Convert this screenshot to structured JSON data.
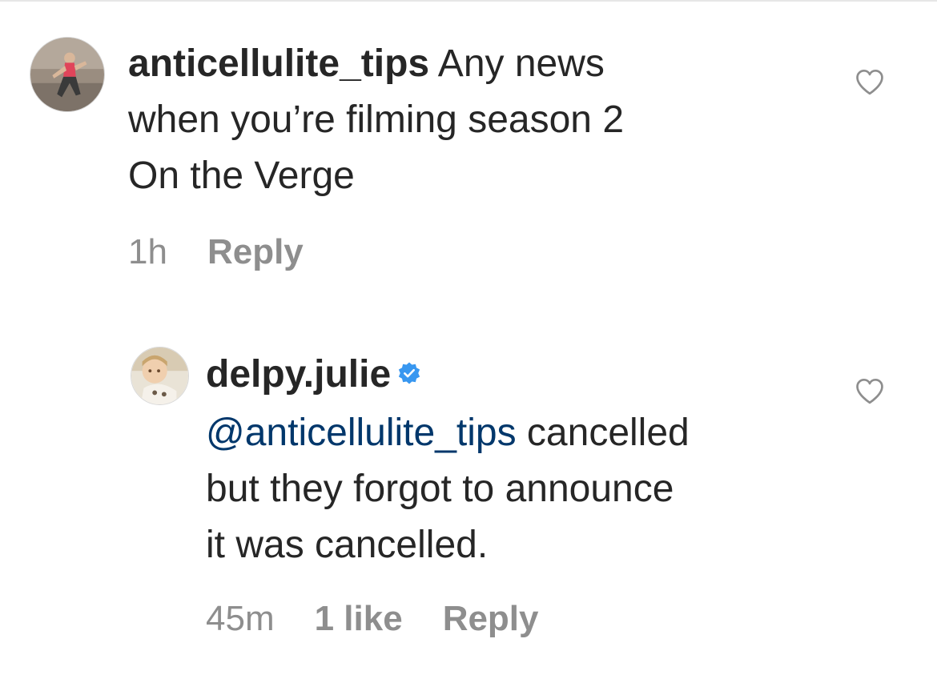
{
  "comments": [
    {
      "username": "anticellulite_tips",
      "text_line1": " Any news",
      "text_line2": "when you’re filming season 2",
      "text_line3": "On the Verge",
      "time": "1h",
      "reply_label": "Reply",
      "avatar_icon": "fitness-photo-avatar",
      "like_icon": "heart-outline-icon"
    },
    {
      "username": "delpy.julie",
      "verified": true,
      "mention": "@anticellulite_tips",
      "text_line1": " cancelled",
      "text_line2": "but they forgot to announce",
      "text_line3": "it was cancelled.",
      "time": "45m",
      "likes_label": "1 like",
      "reply_label": "Reply",
      "avatar_icon": "child-photo-avatar",
      "like_icon": "heart-outline-icon",
      "verified_icon": "verified-badge-icon"
    }
  ],
  "colors": {
    "text": "#262626",
    "muted": "#8e8e8e",
    "mention": "#00376b",
    "verified": "#3897f0"
  }
}
